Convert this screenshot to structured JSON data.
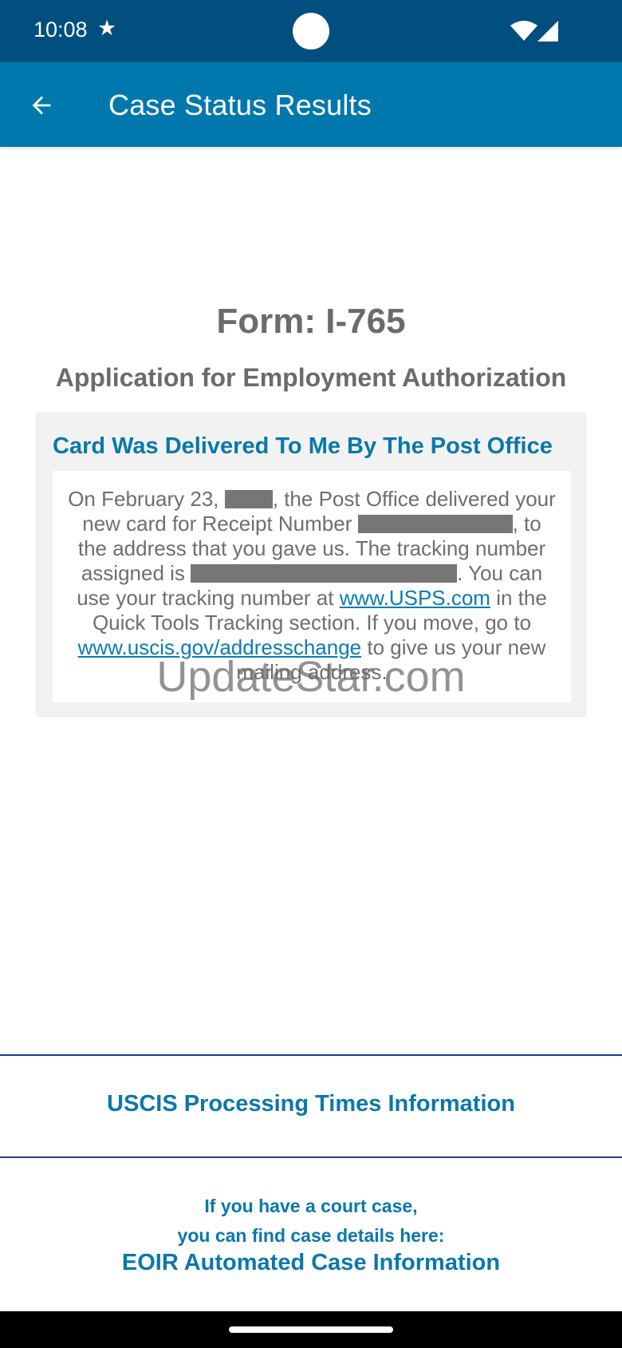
{
  "status_bar": {
    "time": "10:08",
    "star": "★"
  },
  "app_bar": {
    "title": "Case Status Results",
    "back_icon": "arrow-back-icon"
  },
  "form": {
    "title": "Form: I-765",
    "subtitle": "Application for Employment Authorization"
  },
  "status_card": {
    "title": "Card Was Delivered To Me By The Post Office",
    "text": {
      "p1": "On February 23, ",
      "p2": ", the Post Office delivered your new card for Receipt Number ",
      "p3": ", to the address that you gave us. The tracking number assigned is ",
      "p4": ". You can use your tracking number at ",
      "usps_link": "www.USPS.com",
      "p5": " in the Quick Tools Tracking section. If you move, go to ",
      "address_link": "www.uscis.gov/addresschange",
      "p6": " to give us your new mailing address."
    }
  },
  "watermark": "UpdateStar.com",
  "footer": {
    "processing_times": "USCIS Processing Times Information",
    "court_line1": "If you have a court case,",
    "court_line2": "you can find case details here:",
    "eoir_link": "EOIR Automated Case Information"
  },
  "colors": {
    "status_bar": "#004f7f",
    "app_bar": "#0078ad",
    "accent": "#0a78ab",
    "gray_text": "#6b6b6b"
  }
}
